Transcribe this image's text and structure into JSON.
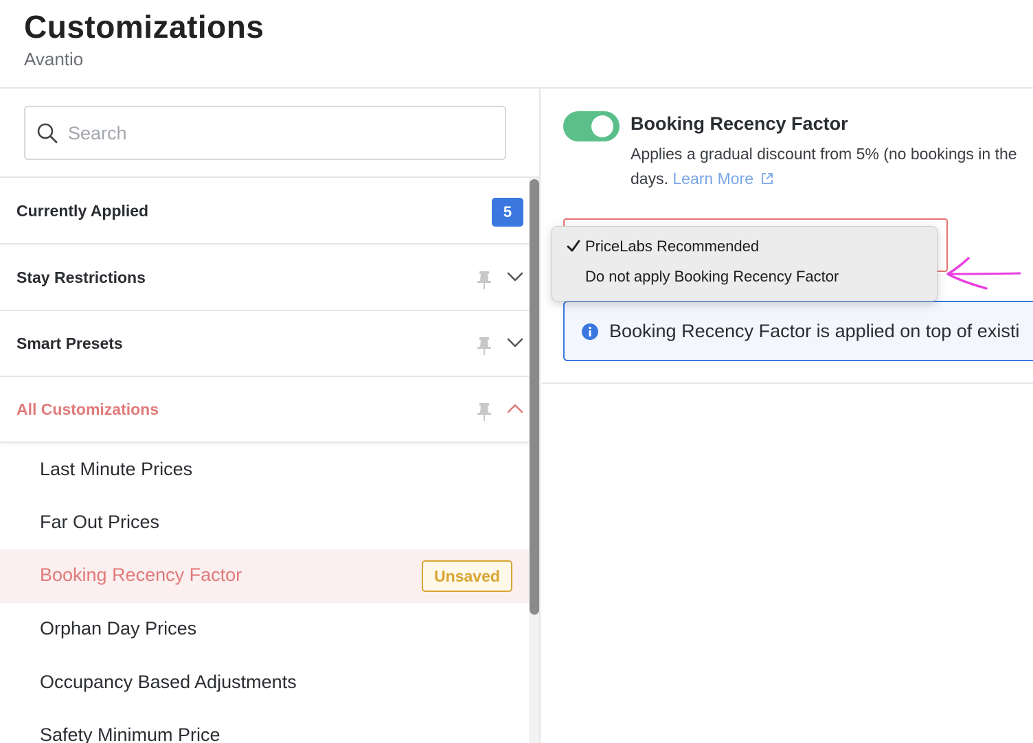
{
  "header": {
    "title": "Customizations",
    "subtitle": "Avantio"
  },
  "search": {
    "placeholder": "Search"
  },
  "sections": [
    {
      "label": "Currently Applied",
      "count": "5"
    },
    {
      "label": "Stay Restrictions"
    },
    {
      "label": "Smart Presets"
    },
    {
      "label": "All Customizations"
    }
  ],
  "items": [
    {
      "label": "Last Minute Prices"
    },
    {
      "label": "Far Out Prices"
    },
    {
      "label": "Booking Recency Factor",
      "badge": "Unsaved"
    },
    {
      "label": "Orphan Day Prices"
    },
    {
      "label": "Occupancy Based Adjustments"
    },
    {
      "label": "Safety Minimum Price"
    }
  ],
  "detail": {
    "title": "Booking Recency Factor",
    "description_line1": "Applies a gradual discount from 5% (no bookings in the",
    "description_line2": "days.",
    "learn_more": "Learn More",
    "dropdown_options": [
      {
        "label": "PriceLabs Recommended",
        "selected": true
      },
      {
        "label": "Do not apply Booking Recency Factor",
        "selected": false
      }
    ],
    "info_text": "Booking Recency Factor is applied on top of existi"
  },
  "colors": {
    "accent_blue": "#3a78e0",
    "active_red": "#e07a7a",
    "toggle_green": "#5bbf8a",
    "unsaved_gold": "#d9a532",
    "annotation_magenta": "#e83fe0"
  },
  "icons": [
    "search-icon",
    "pin-icon",
    "chevron-down-icon",
    "chevron-up-icon",
    "external-link-icon",
    "checkmark-icon",
    "info-icon",
    "arrow-annotation"
  ]
}
